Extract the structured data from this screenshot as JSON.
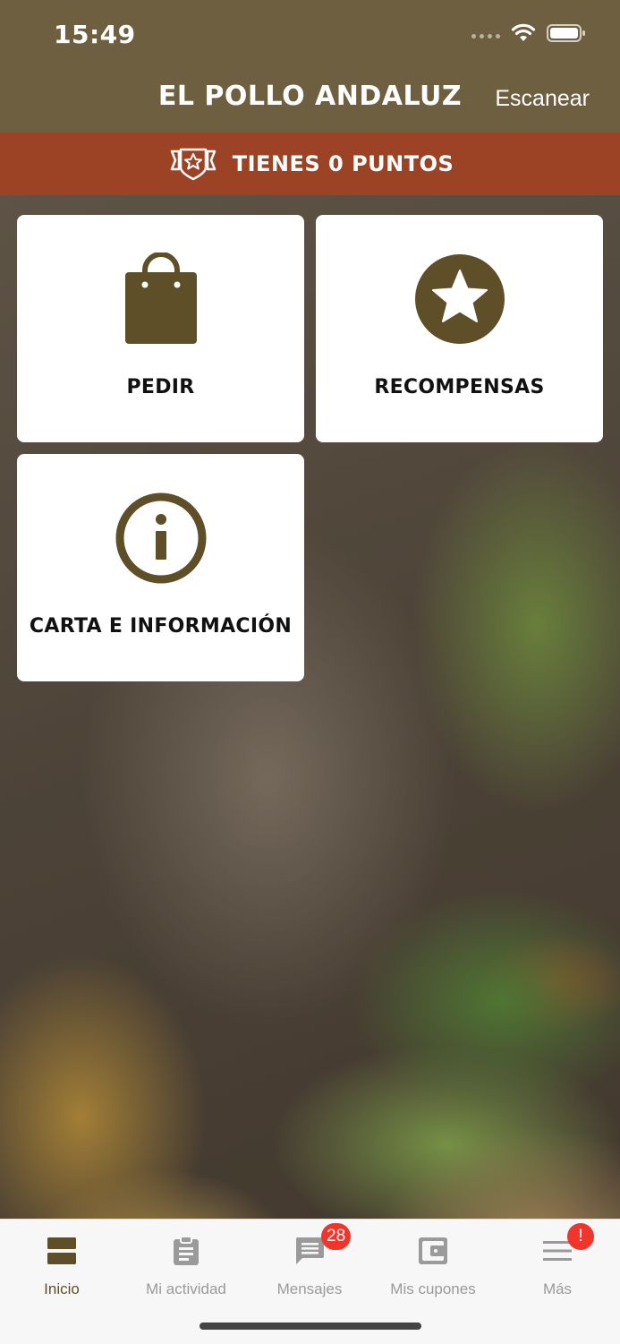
{
  "status_bar": {
    "time": "15:49"
  },
  "nav": {
    "title": "EL POLLO ANDALUZ",
    "action_label": "Escanear"
  },
  "points_banner": {
    "text": "TIENES 0 PUNTOS"
  },
  "tiles": [
    {
      "label": "PEDIR",
      "icon": "shopping-bag-icon"
    },
    {
      "label": "RECOMPENSAS",
      "icon": "star-icon"
    },
    {
      "label": "CARTA E INFORMACIÓN",
      "icon": "info-icon"
    }
  ],
  "tab_bar": {
    "tabs": [
      {
        "label": "Inicio",
        "icon": "home-grid-icon",
        "active": true
      },
      {
        "label": "Mi actividad",
        "icon": "clipboard-icon"
      },
      {
        "label": "Mensajes",
        "icon": "chat-icon",
        "badge": "28"
      },
      {
        "label": "Mis cupones",
        "icon": "wallet-icon"
      },
      {
        "label": "Más",
        "icon": "menu-icon",
        "badge": "!"
      }
    ]
  },
  "colors": {
    "header": "#6e5f40",
    "banner": "#9c4326",
    "icon_brown": "#5e4f28",
    "badge_red": "#f0352d"
  }
}
